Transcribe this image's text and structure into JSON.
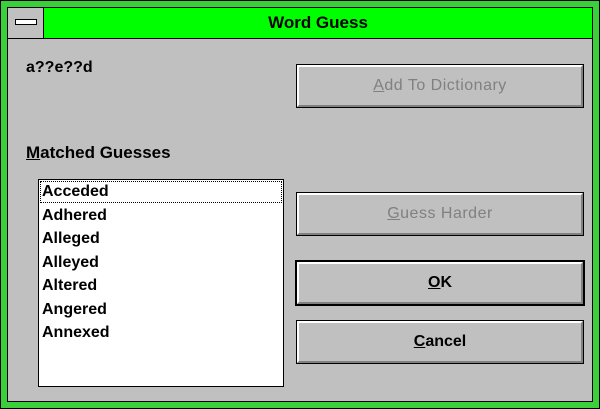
{
  "window": {
    "title": "Word Guess"
  },
  "pattern_text": "a??e??d",
  "matched_label": {
    "accel": "M",
    "rest": "atched Guesses"
  },
  "matches": [
    "Acceded",
    "Adhered",
    "Alleged",
    "Alleyed",
    "Altered",
    "Angered",
    "Annexed"
  ],
  "buttons": {
    "add": {
      "accel": "A",
      "rest": "dd To Dictionary"
    },
    "harder": {
      "accel": "G",
      "rest": "uess Harder"
    },
    "ok": {
      "accel": "O",
      "rest": "K"
    },
    "cancel": {
      "accel": "C",
      "rest": "ancel"
    }
  },
  "colors": {
    "title_bar": "#00ff00",
    "frame": "#3bcf3b",
    "face": "#c0c0c0"
  },
  "icons": {
    "system_menu": "system-menu-icon"
  }
}
